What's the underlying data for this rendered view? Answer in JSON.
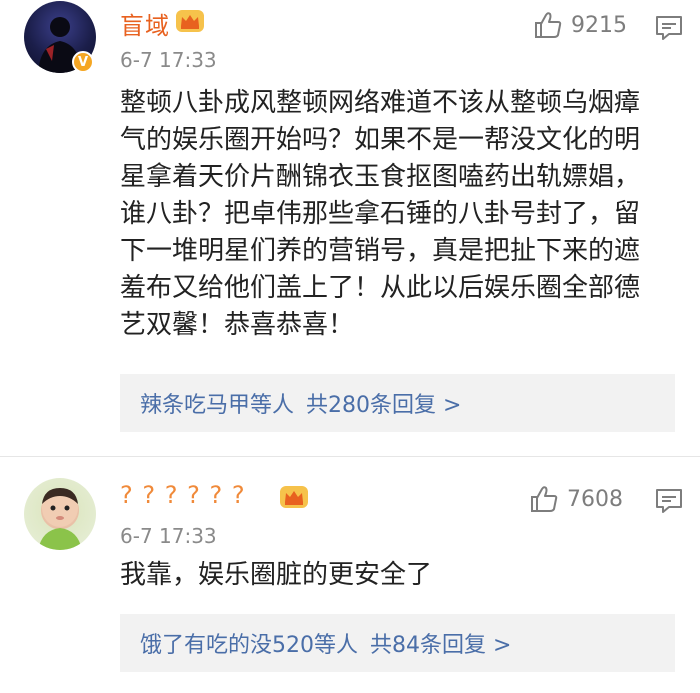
{
  "comments": [
    {
      "username": "盲域",
      "time": "6-7 17:33",
      "likes": "9215",
      "content": "整顿八卦成风整顿网络难道不该从整顿乌烟瘴气的娱乐圈开始吗？如果不是一帮没文化的明星拿着天价片酬锦衣玉食抠图嗑药出轨嫖娼，谁八卦？把卓伟那些拿石锤的八卦号封了，留下一堆明星们养的营销号，真是把扯下来的遮羞布又给他们盖上了！从此以后娱乐圈全部德艺双馨！恭喜恭喜！",
      "reply_users": "辣条吃马甲等人",
      "reply_count": "共280条回复 >",
      "verified_badge": "V"
    },
    {
      "username": "? ? ? ? ? ?",
      "time": "6-7 17:33",
      "likes": "7608",
      "content": "我靠，娱乐圈脏的更安全了",
      "reply_users": "饿了有吃的没520等人",
      "reply_count": "共84条回复 >"
    }
  ],
  "icons": {
    "like": "thumbs-up-icon",
    "reply": "comment-bubble-icon",
    "vip": "crown-icon"
  },
  "colors": {
    "username": "#e8611f",
    "reply_link": "#4a6ea8",
    "meta": "#8a8a8a"
  }
}
